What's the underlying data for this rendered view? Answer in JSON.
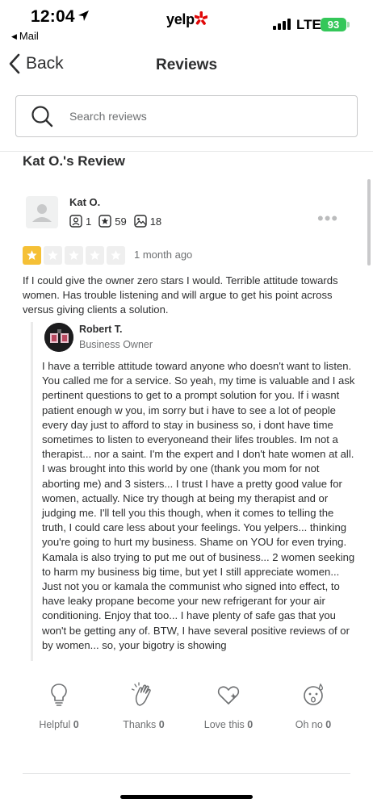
{
  "status_bar": {
    "time": "12:04",
    "back_app": "Mail",
    "app_logo": "yelp",
    "network": "LTE",
    "battery": "93"
  },
  "nav": {
    "back_label": "Back",
    "title": "Reviews"
  },
  "search": {
    "placeholder": "Search reviews"
  },
  "section_title": "Kat O.'s Review",
  "review": {
    "reviewer_name": "Kat O.",
    "stats": {
      "friends": "1",
      "reviews": "59",
      "photos": "18"
    },
    "rating": 1,
    "rating_max": 5,
    "date": "1 month ago",
    "text": "If I could give the owner zero stars I would. Terrible attitude towards women. Has trouble listening and will argue to get his point across versus giving clients a solution."
  },
  "owner_reply": {
    "name": "Robert T.",
    "role": "Business Owner",
    "text": "I have a terrible attitude toward anyone who doesn't want to listen. You called me for a service. So yeah, my time is valuable and I ask pertinent questions to get to a prompt solution for you. If i wasnt patient enough w you, im sorry but i have to see a lot of people every day just to afford to stay in business so, i dont have time sometimes to listen to everyoneand their lifes troubles. Im not a therapist... nor a saint. I'm the expert and I don't hate women at all. I was brought into this world by one (thank you mom for not aborting me) and 3 sisters... I trust I have a pretty good value for women, actually. Nice try though at being my therapist and or judging me. I'll tell you this though, when it comes to telling the truth,  I could care less about your feelings. You yelpers... thinking you're going to hurt my business. Shame on YOU for even trying. Kamala is also trying to put me out of business... 2 women seeking to harm my business big time, but yet I still appreciate women... Just not you or kamala the communist who signed into effect, to have leaky propane become your new refrigerant for your air conditioning. Enjoy that too... I have plenty of safe gas that you won't be getting any of. BTW, I have several positive reviews of or by women... so, your bigotry is showing"
  },
  "reactions": [
    {
      "label": "Helpful",
      "count": "0",
      "icon": "lightbulb-icon"
    },
    {
      "label": "Thanks",
      "count": "0",
      "icon": "hands-icon"
    },
    {
      "label": "Love this",
      "count": "0",
      "icon": "heart-icon"
    },
    {
      "label": "Oh no",
      "count": "0",
      "icon": "oh-no-face-icon"
    }
  ],
  "colors": {
    "star_filled": "#f5c036",
    "star_empty": "#efefef",
    "battery": "#34c759",
    "yelp_red": "#e00707"
  }
}
